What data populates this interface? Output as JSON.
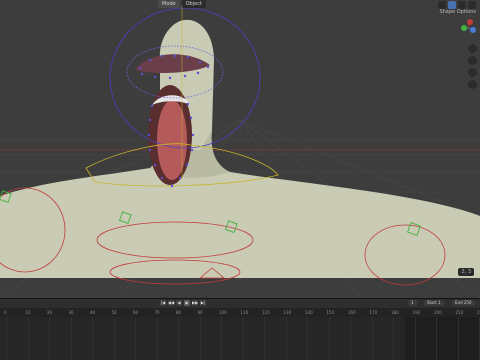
{
  "header": {
    "tabs": [
      {
        "label": "Mode",
        "active": true
      },
      {
        "label": "Object",
        "active": false
      }
    ],
    "view_label": "Shape Options"
  },
  "viewport": {
    "counter": "2, 3"
  },
  "timeline": {
    "transport": [
      "|◀",
      "◀◀",
      "◀",
      "▶",
      "▶▶",
      "▶|"
    ],
    "current_frame": "1",
    "start_label": "Start",
    "start_value": "1",
    "end_label": "End",
    "end_value": "250",
    "ticks": [
      "0",
      "10",
      "20",
      "30",
      "40",
      "50",
      "60",
      "70",
      "80",
      "90",
      "100",
      "110",
      "120",
      "130",
      "140",
      "150",
      "160",
      "170",
      "180",
      "190",
      "200",
      "210",
      "220"
    ]
  },
  "colors": {
    "viewport_bg": "#3d3d3d",
    "mesh": "#c9cbb4",
    "rig_blue": "#4a3fc7",
    "rig_red": "#c23b3b",
    "rig_yellow": "#c8b52a",
    "rig_green": "#3fb33f",
    "mouth_inner": "#b45a5a"
  }
}
